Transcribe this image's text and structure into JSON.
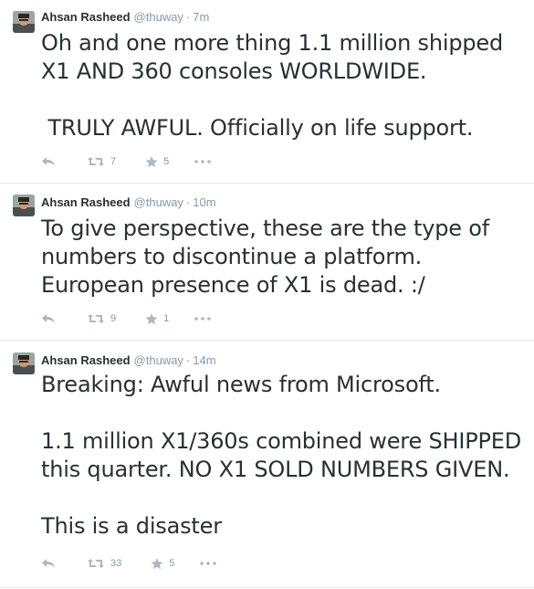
{
  "tweets": [
    {
      "name": "Ahsan Rasheed",
      "handle": "@thuway",
      "separator": "·",
      "time": "7m",
      "text": "Oh and one more thing 1.1 million shipped\nX1 AND 360 consoles WORLDWIDE.\n\n TRULY AWFUL. Officially on life support.",
      "retweets": "7",
      "favorites": "5"
    },
    {
      "name": "Ahsan Rasheed",
      "handle": "@thuway",
      "separator": "·",
      "time": "10m",
      "text": "To give perspective, these are the type of\nnumbers to discontinue a platform.\nEuropean presence of X1 is dead. :/",
      "retweets": "9",
      "favorites": "1"
    },
    {
      "name": "Ahsan Rasheed",
      "handle": "@thuway",
      "separator": "·",
      "time": "14m",
      "text": "Breaking: Awful news from Microsoft.\n\n1.1 million X1/360s combined were SHIPPED\nthis quarter. NO X1 SOLD NUMBERS GIVEN.\n\nThis is a disaster",
      "retweets": "33",
      "favorites": "5"
    }
  ],
  "icons": {
    "reply": "reply-icon",
    "retweet": "retweet-icon",
    "favorite": "star-icon",
    "more": "more-icon"
  },
  "colors": {
    "text": "#292f33",
    "meta": "#8899a6",
    "icon": "#aab8c2",
    "divider": "#e1e8ed"
  }
}
